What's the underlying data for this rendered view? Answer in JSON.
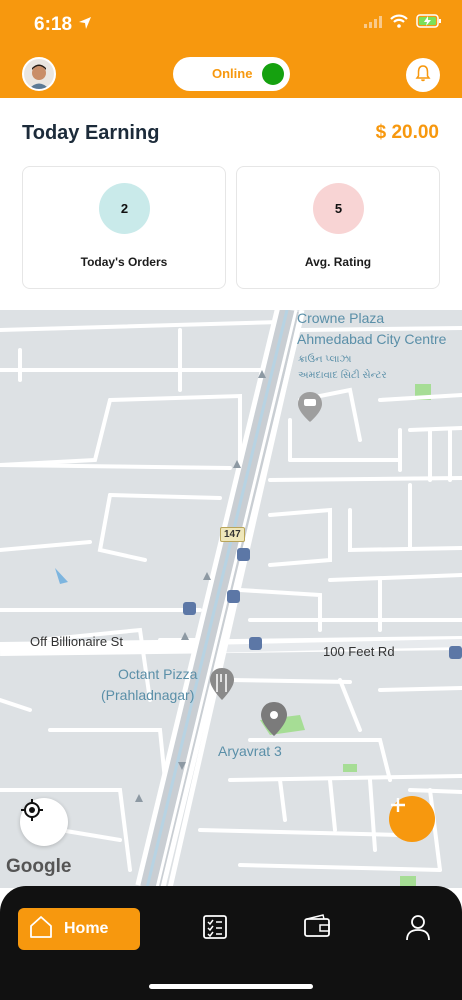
{
  "status_bar": {
    "time": "6:18"
  },
  "header": {
    "toggle_label": "Online"
  },
  "earnings": {
    "title": "Today Earning",
    "value": "$ 20.00"
  },
  "stats": [
    {
      "value": "2",
      "label": "Today's Orders"
    },
    {
      "value": "5",
      "label": "Avg. Rating"
    }
  ],
  "map": {
    "labels": {
      "hotel_en1": "Crowne Plaza",
      "hotel_en2": "Ahmedabad City Centre",
      "hotel_gu1": "ક્રાઉન પ્લાઝા",
      "hotel_gu2": "અમદાવાદ સિટી સેન્ટર",
      "road_billionaire": "Off Billionaire St",
      "road_100ft": "100 Feet Rd",
      "place_pizza1": "Octant Pizza",
      "place_pizza2": "(Prahladnagar)",
      "place_aryavrat": "Aryavrat 3",
      "highway_shield": "147",
      "attribution": "Google"
    }
  },
  "bottom_nav": {
    "home_label": "Home"
  },
  "colors": {
    "accent": "#f7980e",
    "online": "#15a10f",
    "nav_bg": "#111111"
  }
}
